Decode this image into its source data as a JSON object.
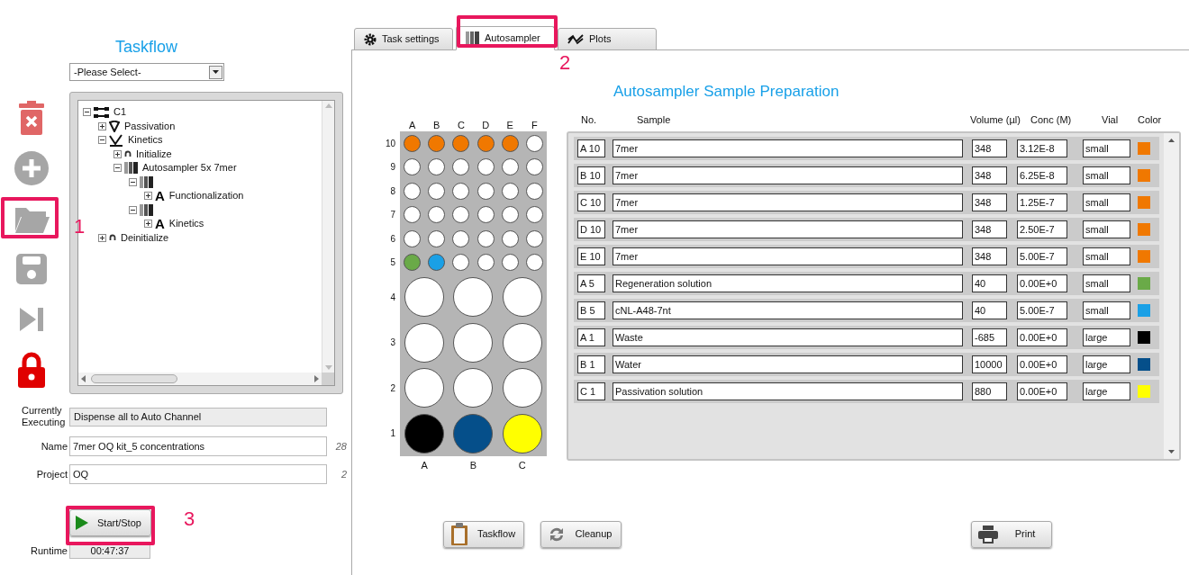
{
  "toolbar": [
    {
      "kind": "delete",
      "highlighted": false
    },
    {
      "kind": "add",
      "highlighted": false
    },
    {
      "kind": "open",
      "highlighted": true,
      "callout": "1"
    },
    {
      "kind": "save",
      "highlighted": false
    },
    {
      "kind": "skip",
      "highlighted": false
    },
    {
      "kind": "lock",
      "highlighted": false
    }
  ],
  "taskflow": {
    "title": "Taskflow",
    "select": {
      "value": "-Please Select-"
    },
    "tree": [
      {
        "label": "C1",
        "kind": "group",
        "expanded": true,
        "children": [
          {
            "label": "Passivation",
            "kind": "shield",
            "expanded": false
          },
          {
            "label": "Kinetics",
            "kind": "kinetics",
            "expanded": true,
            "children": [
              {
                "label": "Initialize",
                "kind": "loop",
                "expanded": false
              },
              {
                "label": "Autosampler 5x 7mer",
                "kind": "vials",
                "expanded": true,
                "children": [
                  {
                    "kind": "vials",
                    "expanded": true,
                    "children": [
                      {
                        "label": "Functionalization",
                        "kind": "glyph",
                        "glyph": "A",
                        "expanded": false
                      }
                    ]
                  },
                  {
                    "kind": "vials",
                    "expanded": true,
                    "children": [
                      {
                        "label": "Kinetics",
                        "kind": "glyph",
                        "glyph": "A",
                        "expanded": false
                      }
                    ]
                  }
                ]
              }
            ]
          },
          {
            "label": "Deinitialize",
            "kind": "loop",
            "expanded": false
          }
        ]
      }
    ]
  },
  "status": {
    "executing": {
      "label": "Currently Executing",
      "value": "Dispense all to Auto Channel"
    },
    "fields": [
      {
        "label": "Name",
        "value": "7mer OQ kit_5 concentrations",
        "count": "28"
      },
      {
        "label": "Project",
        "value": "OQ",
        "count": "2"
      }
    ],
    "start_button": {
      "label": "Start/Stop",
      "highlighted": true,
      "callout": "3"
    },
    "runtime": {
      "label": "Runtime",
      "value": "00:47:37"
    }
  },
  "tabs": [
    {
      "label": "Task settings",
      "kind": "gear",
      "selected": false,
      "highlighted": false
    },
    {
      "label": "Autosampler",
      "kind": "vials",
      "selected": true,
      "highlighted": true,
      "callout": "2"
    },
    {
      "label": "Plots",
      "kind": "chart",
      "selected": false,
      "highlighted": false
    }
  ],
  "autosampler": {
    "title": "Autosampler Sample Preparation",
    "plate": {
      "column_labels": [
        "A",
        "B",
        "C",
        "D",
        "E",
        "F"
      ],
      "bottom_labels": [
        "A",
        "B",
        "C"
      ],
      "small_rows": [
        {
          "label": "10",
          "wells": [
            {
              "color": "#f07800"
            },
            {
              "color": "#f07800"
            },
            {
              "color": "#f07800"
            },
            {
              "color": "#f07800"
            },
            {
              "color": "#f07800"
            },
            {
              "color": "#ffffff"
            }
          ]
        },
        {
          "label": "9",
          "wells": [
            {
              "color": "#ffffff"
            },
            {
              "color": "#ffffff"
            },
            {
              "color": "#ffffff"
            },
            {
              "color": "#ffffff"
            },
            {
              "color": "#ffffff"
            },
            {
              "color": "#ffffff"
            }
          ]
        },
        {
          "label": "8",
          "wells": [
            {
              "color": "#ffffff"
            },
            {
              "color": "#ffffff"
            },
            {
              "color": "#ffffff"
            },
            {
              "color": "#ffffff"
            },
            {
              "color": "#ffffff"
            },
            {
              "color": "#ffffff"
            }
          ]
        },
        {
          "label": "7",
          "wells": [
            {
              "color": "#ffffff"
            },
            {
              "color": "#ffffff"
            },
            {
              "color": "#ffffff"
            },
            {
              "color": "#ffffff"
            },
            {
              "color": "#ffffff"
            },
            {
              "color": "#ffffff"
            }
          ]
        },
        {
          "label": "6",
          "wells": [
            {
              "color": "#ffffff"
            },
            {
              "color": "#ffffff"
            },
            {
              "color": "#ffffff"
            },
            {
              "color": "#ffffff"
            },
            {
              "color": "#ffffff"
            },
            {
              "color": "#ffffff"
            }
          ]
        },
        {
          "label": "5",
          "wells": [
            {
              "color": "#6aaa48"
            },
            {
              "color": "#1aa0e6"
            },
            {
              "color": "#ffffff"
            },
            {
              "color": "#ffffff"
            },
            {
              "color": "#ffffff"
            },
            {
              "color": "#ffffff"
            }
          ]
        }
      ],
      "large_rows": [
        {
          "label": "4",
          "wells": [
            {
              "color": "#ffffff"
            },
            {
              "color": "#ffffff"
            },
            {
              "color": "#ffffff"
            }
          ]
        },
        {
          "label": "3",
          "wells": [
            {
              "color": "#ffffff"
            },
            {
              "color": "#ffffff"
            },
            {
              "color": "#ffffff"
            }
          ]
        },
        {
          "label": "2",
          "wells": [
            {
              "color": "#ffffff"
            },
            {
              "color": "#ffffff"
            },
            {
              "color": "#ffffff"
            }
          ]
        },
        {
          "label": "1",
          "wells": [
            {
              "color": "#000000"
            },
            {
              "color": "#054f8a"
            },
            {
              "color": "#ffff00"
            }
          ]
        }
      ]
    },
    "table": {
      "columns": [
        "No.",
        "Sample",
        "Volume (µl)",
        "Conc (M)",
        "Vial",
        "Color"
      ],
      "rows": [
        {
          "no": "A 10",
          "sample": "7mer",
          "volume": "348",
          "conc": "3.12E-8",
          "vial": "small",
          "color": "#f07800"
        },
        {
          "no": "B 10",
          "sample": "7mer",
          "volume": "348",
          "conc": "6.25E-8",
          "vial": "small",
          "color": "#f07800"
        },
        {
          "no": "C 10",
          "sample": "7mer",
          "volume": "348",
          "conc": "1.25E-7",
          "vial": "small",
          "color": "#f07800"
        },
        {
          "no": "D 10",
          "sample": "7mer",
          "volume": "348",
          "conc": "2.50E-7",
          "vial": "small",
          "color": "#f07800"
        },
        {
          "no": "E 10",
          "sample": "7mer",
          "volume": "348",
          "conc": "5.00E-7",
          "vial": "small",
          "color": "#f07800"
        },
        {
          "no": "A 5",
          "sample": "Regeneration solution",
          "volume": "40",
          "conc": "0.00E+0",
          "vial": "small",
          "color": "#6aaa48"
        },
        {
          "no": "B 5",
          "sample": "cNL-A48-7nt",
          "volume": "40",
          "conc": "5.00E-7",
          "vial": "small",
          "color": "#1aa0e6"
        },
        {
          "no": "A 1",
          "sample": "Waste",
          "volume": "-685",
          "conc": "0.00E+0",
          "vial": "large",
          "color": "#000000"
        },
        {
          "no": "B 1",
          "sample": "Water",
          "volume": "10000",
          "conc": "0.00E+0",
          "vial": "large",
          "color": "#054f8a"
        },
        {
          "no": "C 1",
          "sample": "Passivation solution",
          "volume": "880",
          "conc": "0.00E+0",
          "vial": "large",
          "color": "#ffff00"
        }
      ]
    },
    "buttons": [
      {
        "label": "Taskflow",
        "kind": "clipboard"
      },
      {
        "label": "Cleanup",
        "kind": "refresh"
      },
      {
        "label": "Print",
        "kind": "printer"
      }
    ]
  }
}
